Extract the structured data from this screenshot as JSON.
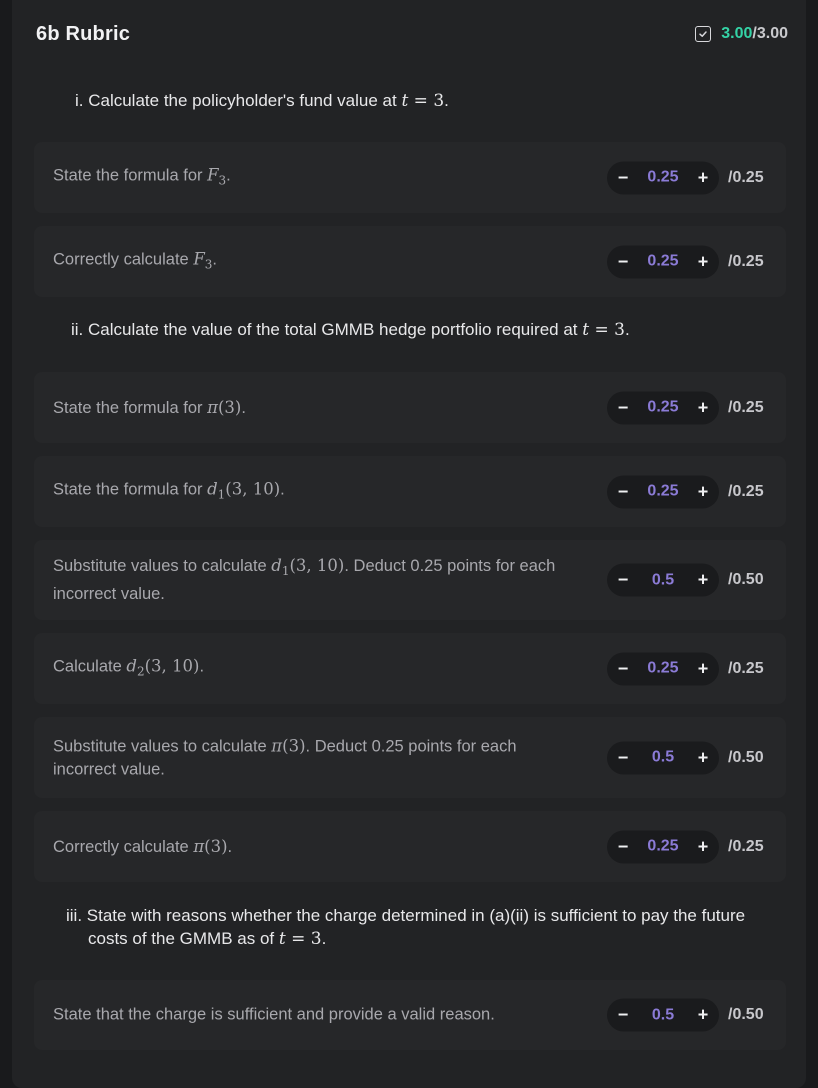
{
  "header": {
    "title": "6b Rubric",
    "score_got": "3.00",
    "score_total": "/3.00"
  },
  "questions": [
    {
      "pre": "i. Calculate the policyholder's fund value at ",
      "math_var": "t",
      "math_rest": " = 3",
      "post": "."
    },
    {
      "pre": "ii. Calculate the value of the total GMMB hedge portfolio required at ",
      "math_var": "t",
      "math_rest": " = 3",
      "post": "."
    },
    {
      "line1": "iii. State with reasons whether the charge determined in (a)(ii) is sufficient to pay the future",
      "pre": "costs of the GMMB as of ",
      "math_var": "t",
      "math_rest": " = 3",
      "post": "."
    }
  ],
  "criteria": [
    {
      "pre": "State the formula for ",
      "math_var": "F",
      "math_sub": "3",
      "math_rest": "",
      "post": ".",
      "value": "0.25",
      "max": "/0.25"
    },
    {
      "pre": "Correctly calculate ",
      "math_var": "F",
      "math_sub": "3",
      "math_rest": "",
      "post": ".",
      "value": "0.25",
      "max": "/0.25"
    },
    {
      "pre": "State the formula for ",
      "math_var": "π",
      "math_sub": "",
      "math_rest": "(3)",
      "post": ".",
      "value": "0.25",
      "max": "/0.25"
    },
    {
      "pre": "State the formula for ",
      "math_var": "d",
      "math_sub": "1",
      "math_rest": "(3, 10)",
      "post": ".",
      "value": "0.25",
      "max": "/0.25"
    },
    {
      "pre": "Substitute values to calculate ",
      "math_var": "d",
      "math_sub": "1",
      "math_rest": "(3, 10)",
      "post": ". Deduct 0.25 points for each",
      "line2": "incorrect value.",
      "value": "0.5",
      "max": "/0.50"
    },
    {
      "pre": "Calculate ",
      "math_var": "d",
      "math_sub": "2",
      "math_rest": "(3, 10)",
      "post": ".",
      "value": "0.25",
      "max": "/0.25"
    },
    {
      "pre": "Substitute values to calculate ",
      "math_var": "π",
      "math_sub": "",
      "math_rest": "(3)",
      "post": ". Deduct 0.25 points for each",
      "line2": "incorrect value.",
      "value": "0.5",
      "max": "/0.50"
    },
    {
      "pre": "Correctly calculate ",
      "math_var": "π",
      "math_sub": "",
      "math_rest": "(3)",
      "post": ".",
      "value": "0.25",
      "max": "/0.25"
    },
    {
      "pre": "State that the charge is sufficient and provide a valid reason.",
      "math_var": "",
      "math_sub": "",
      "math_rest": "",
      "post": "",
      "value": "0.5",
      "max": "/0.50"
    }
  ],
  "controls": {
    "decrement": "−",
    "increment": "+"
  },
  "icons": {
    "score": "checkbox-checked-icon"
  },
  "colors": {
    "score_accent": "#34d3a6",
    "points_value": "#8b7bd6"
  }
}
